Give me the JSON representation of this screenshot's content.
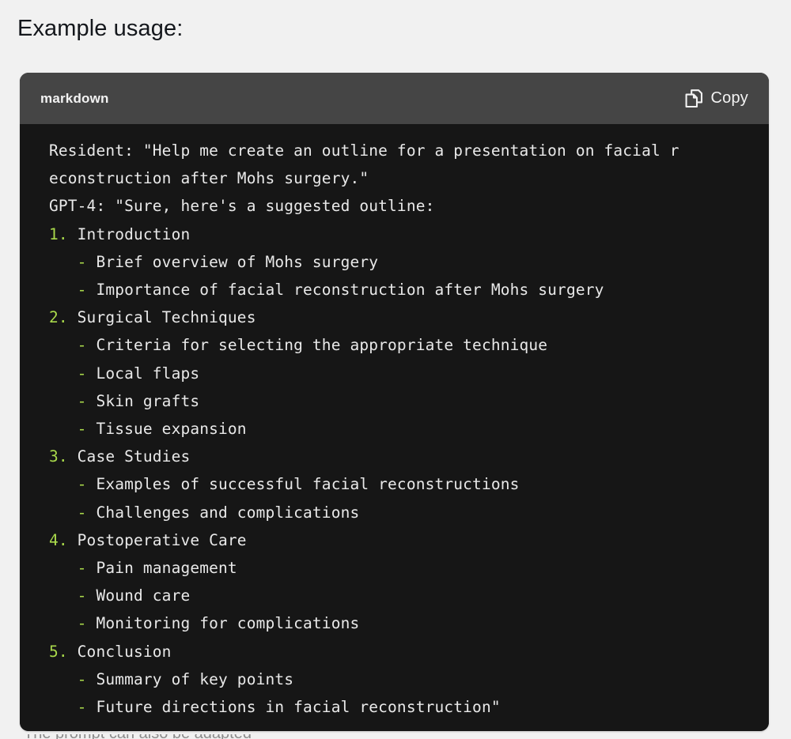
{
  "heading": "Example usage:",
  "code_block": {
    "language_label": "markdown",
    "copy_label": "Copy",
    "copy_icon": "copy-icon",
    "header_bg": "#454545",
    "body_bg": "#161616",
    "text_color": "#e8e8e8",
    "accent_color": "#a9d94b",
    "lines": [
      {
        "type": "plain",
        "text": "Resident: \"Help me create an outline for a presentation on facial r"
      },
      {
        "type": "plain",
        "text": "econstruction after Mohs surgery.\""
      },
      {
        "type": "plain",
        "text": "GPT-4: \"Sure, here's a suggested outline:"
      },
      {
        "type": "ordered",
        "marker": "1.",
        "text": " Introduction"
      },
      {
        "type": "bullet",
        "marker": "-",
        "indent": "   ",
        "text": " Brief overview of Mohs surgery"
      },
      {
        "type": "bullet",
        "marker": "-",
        "indent": "   ",
        "text": " Importance of facial reconstruction after Mohs surgery"
      },
      {
        "type": "ordered",
        "marker": "2.",
        "text": " Surgical Techniques"
      },
      {
        "type": "bullet",
        "marker": "-",
        "indent": "   ",
        "text": " Criteria for selecting the appropriate technique"
      },
      {
        "type": "bullet",
        "marker": "-",
        "indent": "   ",
        "text": " Local flaps"
      },
      {
        "type": "bullet",
        "marker": "-",
        "indent": "   ",
        "text": " Skin grafts"
      },
      {
        "type": "bullet",
        "marker": "-",
        "indent": "   ",
        "text": " Tissue expansion"
      },
      {
        "type": "ordered",
        "marker": "3.",
        "text": " Case Studies"
      },
      {
        "type": "bullet",
        "marker": "-",
        "indent": "   ",
        "text": " Examples of successful facial reconstructions"
      },
      {
        "type": "bullet",
        "marker": "-",
        "indent": "   ",
        "text": " Challenges and complications"
      },
      {
        "type": "ordered",
        "marker": "4.",
        "text": " Postoperative Care"
      },
      {
        "type": "bullet",
        "marker": "-",
        "indent": "   ",
        "text": " Pain management"
      },
      {
        "type": "bullet",
        "marker": "-",
        "indent": "   ",
        "text": " Wound care"
      },
      {
        "type": "bullet",
        "marker": "-",
        "indent": "   ",
        "text": " Monitoring for complications"
      },
      {
        "type": "ordered",
        "marker": "5.",
        "text": " Conclusion"
      },
      {
        "type": "bullet",
        "marker": "-",
        "indent": "   ",
        "text": " Summary of key points"
      },
      {
        "type": "bullet",
        "marker": "-",
        "indent": "   ",
        "text": " Future directions in facial reconstruction\""
      }
    ]
  },
  "cut_off_text_below": "The prompt can also be adapted"
}
